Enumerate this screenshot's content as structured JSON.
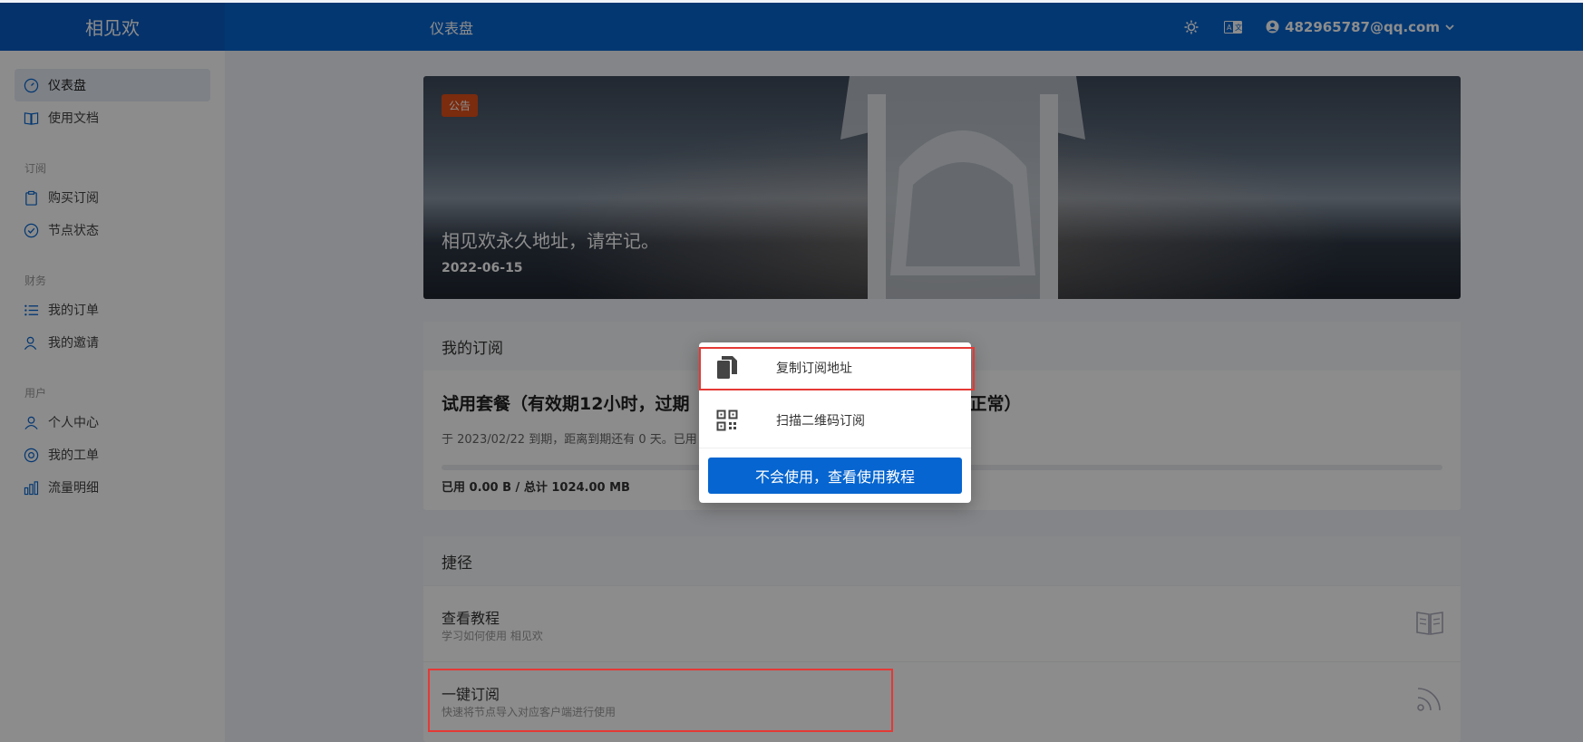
{
  "header": {
    "brand": "相见欢",
    "page_title": "仪表盘",
    "user_email": "482965787@qq.com"
  },
  "sidebar": {
    "items_top": [
      {
        "label": "仪表盘",
        "icon": "gauge-icon",
        "active": true
      },
      {
        "label": "使用文档",
        "icon": "book-icon",
        "active": false
      }
    ],
    "group_subscribe": "订阅",
    "items_subscribe": [
      {
        "label": "购买订阅",
        "icon": "clipboard-icon"
      },
      {
        "label": "节点状态",
        "icon": "check-circle-icon"
      }
    ],
    "group_finance": "财务",
    "items_finance": [
      {
        "label": "我的订单",
        "icon": "list-icon"
      },
      {
        "label": "我的邀请",
        "icon": "user-invite-icon"
      }
    ],
    "group_user": "用户",
    "items_user": [
      {
        "label": "个人中心",
        "icon": "user-icon"
      },
      {
        "label": "我的工单",
        "icon": "support-icon"
      },
      {
        "label": "流量明细",
        "icon": "bar-chart-icon"
      }
    ]
  },
  "announcement": {
    "badge": "公告",
    "title": "相见欢永久地址，请牢记。",
    "date": "2022-06-15"
  },
  "subscription": {
    "heading": "我的订阅",
    "plan_title": "试用套餐（有效期12小时，过期",
    "plan_title_tail": "复正常）",
    "expire_text": "于 2023/02/22 到期，距离到期还有 0 天。已用",
    "usage_text": "已用 0.00 B / 总计 1024.00 MB",
    "used_fraction": 0
  },
  "shortcuts": {
    "heading": "捷径",
    "items": [
      {
        "title": "查看教程",
        "desc": "学习如何使用 相见欢",
        "icon": "book-open-icon"
      },
      {
        "title": "一键订阅",
        "desc": "快速将节点导入对应客户端进行使用",
        "icon": "rss-icon"
      }
    ]
  },
  "popup": {
    "copy_label": "复制订阅地址",
    "qr_label": "扫描二维码订阅",
    "tutorial_button": "不会使用，查看使用教程"
  },
  "colors": {
    "primary": "#0665d0",
    "highlight": "#e53935",
    "badge": "#e04f1a"
  }
}
